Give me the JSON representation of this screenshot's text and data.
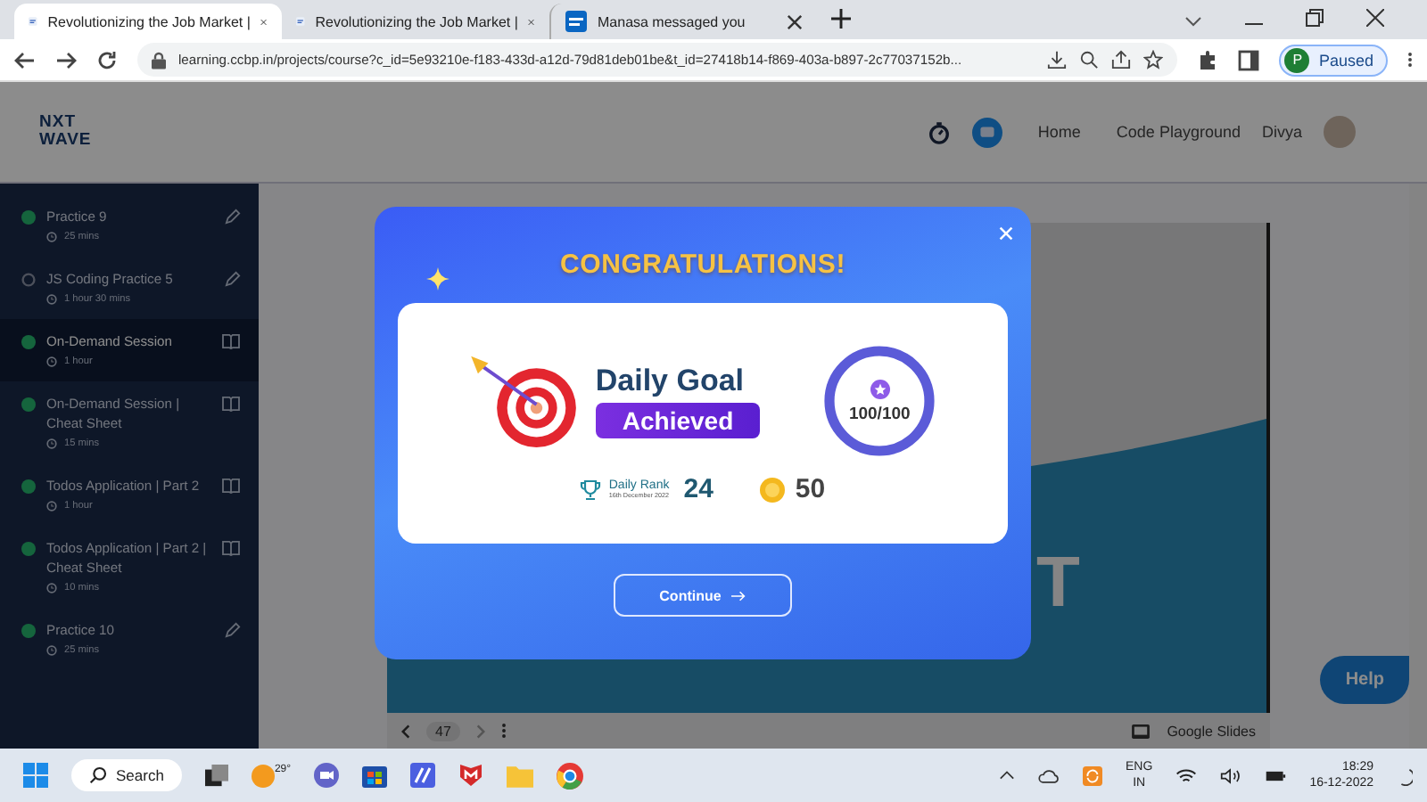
{
  "browser": {
    "tabs": [
      {
        "title": "Revolutionizing the Job Market |",
        "selected": true
      },
      {
        "title": "Revolutionizing the Job Market |",
        "selected": false
      },
      {
        "title": "Manasa messaged you",
        "selected": false
      }
    ],
    "url": "learning.ccbp.in/projects/course?c_id=5e93210e-f183-433d-a12d-79d81deb01be&t_id=27418b14-f869-403a-b897-2c77037152b...",
    "profile_initial": "P",
    "profile_status": "Paused"
  },
  "header": {
    "logo_top": "NXT",
    "logo_bottom": "WAVE",
    "nav": [
      "Home",
      "Code Playground"
    ],
    "user": "Divya"
  },
  "sidebar": {
    "items": [
      {
        "title": "Practice 9",
        "duration": "25 mins",
        "done": true,
        "kind": "edit",
        "selected": false
      },
      {
        "title": "JS Coding Practice 5",
        "duration": "1 hour 30 mins",
        "done": false,
        "kind": "edit",
        "selected": false
      },
      {
        "title": "On-Demand Session",
        "duration": "1 hour",
        "done": true,
        "kind": "book",
        "selected": true
      },
      {
        "title": "On-Demand Session | Cheat Sheet",
        "duration": "15 mins",
        "done": true,
        "kind": "book",
        "selected": false
      },
      {
        "title": "Todos Application | Part 2",
        "duration": "1 hour",
        "done": true,
        "kind": "book",
        "selected": false
      },
      {
        "title": "Todos Application | Part 2 | Cheat Sheet",
        "duration": "10 mins",
        "done": true,
        "kind": "book",
        "selected": false
      },
      {
        "title": "Practice 10",
        "duration": "25 mins",
        "done": true,
        "kind": "edit",
        "selected": false
      }
    ]
  },
  "slide": {
    "text": "T",
    "page": "47",
    "source": "Google Slides"
  },
  "help": "Help",
  "modal": {
    "heading": "CONGRATULATIONS!",
    "goal_title": "Daily Goal",
    "badge": "Achieved",
    "score": "100/100",
    "rank_label": "Daily Rank",
    "rank_date": "16th December 2022",
    "rank": "24",
    "coins": "50",
    "button": "Continue"
  },
  "taskbar": {
    "search": "Search",
    "weather": "29°",
    "lang_top": "ENG",
    "lang_bottom": "IN",
    "time": "18:29",
    "date": "16-12-2022"
  }
}
